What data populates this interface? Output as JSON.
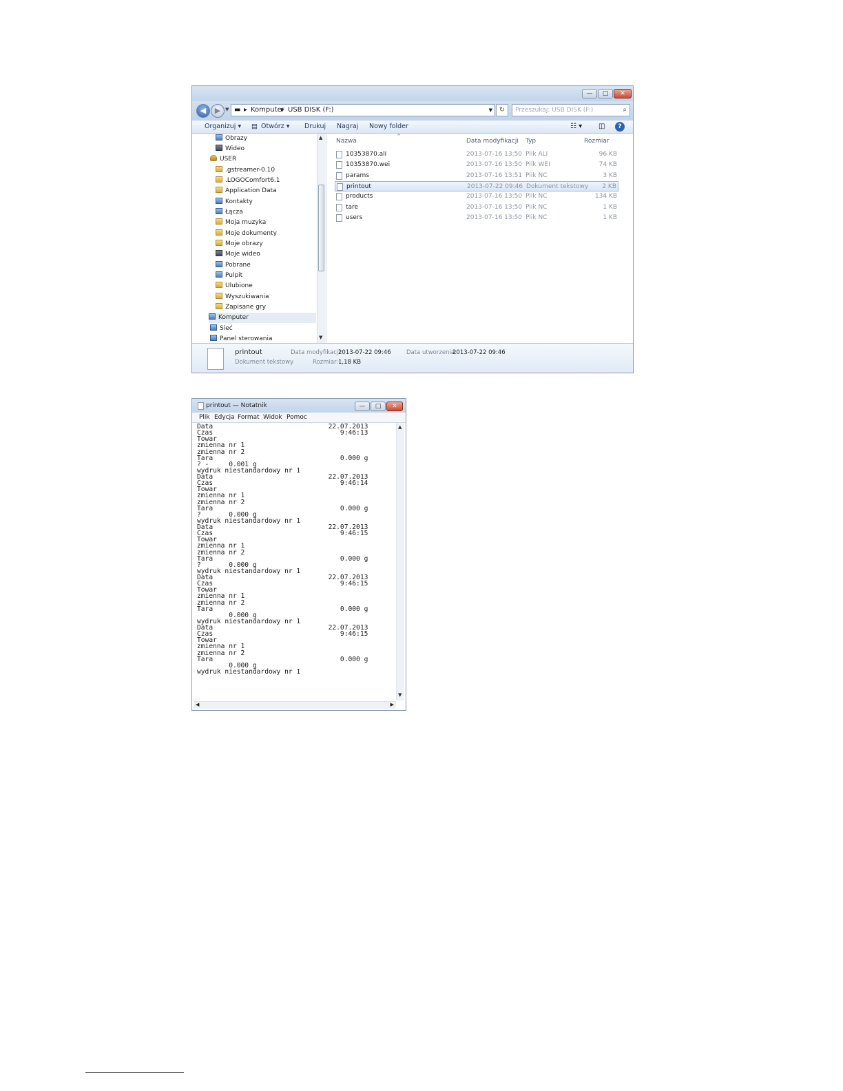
{
  "explorer": {
    "window_controls": {
      "minimize": "—",
      "maximize": "□",
      "close": "✕"
    },
    "nav": {
      "back": "◀",
      "forward": "▶"
    },
    "address": {
      "segments": [
        "Komputer",
        "USB DISK (F:)"
      ],
      "separator": "▸"
    },
    "search": {
      "placeholder": "Przeszukaj: USB DISK (F:)"
    },
    "toolbar": {
      "organize": "Organizuj ▾",
      "open": "Otwórz ▾",
      "print": "Drukuj",
      "burn": "Nagraj",
      "new_folder": "Nowy folder"
    },
    "nav_pane": [
      {
        "label": "Obrazy",
        "icon": "pictures-icon"
      },
      {
        "label": "Wideo",
        "icon": "video-icon"
      },
      {
        "label": "USER",
        "icon": "user-folder-icon"
      },
      {
        "label": ".gstreamer-0.10",
        "icon": "folder-icon"
      },
      {
        "label": ".LOGOComfort6.1",
        "icon": "folder-icon"
      },
      {
        "label": "Application Data",
        "icon": "folder-icon"
      },
      {
        "label": "Kontakty",
        "icon": "contacts-icon"
      },
      {
        "label": "Łącza",
        "icon": "links-icon"
      },
      {
        "label": "Moja muzyka",
        "icon": "folder-icon"
      },
      {
        "label": "Moje dokumenty",
        "icon": "folder-icon"
      },
      {
        "label": "Moje obrazy",
        "icon": "folder-icon"
      },
      {
        "label": "Moje wideo",
        "icon": "folder-icon"
      },
      {
        "label": "Pobrane",
        "icon": "downloads-icon"
      },
      {
        "label": "Pulpit",
        "icon": "desktop-icon"
      },
      {
        "label": "Ulubione",
        "icon": "favorites-icon"
      },
      {
        "label": "Wyszukiwania",
        "icon": "searches-icon"
      },
      {
        "label": "Zapisane gry",
        "icon": "saved-games-icon"
      },
      {
        "label": "Komputer",
        "icon": "computer-icon"
      },
      {
        "label": "Sieć",
        "icon": "network-icon"
      },
      {
        "label": "Panel sterowania",
        "icon": "control-panel-icon"
      }
    ],
    "columns": {
      "name": "Nazwa",
      "modified": "Data modyfikacji",
      "type": "Typ",
      "size": "Rozmiar"
    },
    "files": [
      {
        "name": "10353870.ali",
        "modified": "2013-07-16 13:50",
        "type": "Plik ALI",
        "size": "96 KB"
      },
      {
        "name": "10353870.wei",
        "modified": "2013-07-16 13:50",
        "type": "Plik WEI",
        "size": "74 KB"
      },
      {
        "name": "params",
        "modified": "2013-07-16 13:51",
        "type": "Plik NC",
        "size": "3 KB"
      },
      {
        "name": "printout",
        "modified": "2013-07-22 09:46",
        "type": "Dokument tekstowy",
        "size": "2 KB"
      },
      {
        "name": "products",
        "modified": "2013-07-16 13:50",
        "type": "Plik NC",
        "size": "134 KB"
      },
      {
        "name": "tare",
        "modified": "2013-07-16 13:50",
        "type": "Plik NC",
        "size": "1 KB"
      },
      {
        "name": "users",
        "modified": "2013-07-16 13:50",
        "type": "Plik NC",
        "size": "1 KB"
      }
    ],
    "selected_file": "printout",
    "details": {
      "name": "printout",
      "kind": "Dokument tekstowy",
      "modified_label": "Data modyfikacji:",
      "modified_value": "2013-07-22 09:46",
      "size_label": "Rozmiar:",
      "size_value": "1,18 KB",
      "created_label": "Data utworzenia:",
      "created_value": "2013-07-22 09:46"
    }
  },
  "notepad": {
    "title": "printout — Notatnik",
    "menu": [
      "Plik",
      "Edycja",
      "Format",
      "Widok",
      "Pomoc"
    ],
    "content": "Data                             22.07.2013\nCzas                                9:46:13\nTowar\nzmienna nr 1\nzmienna nr 2\nTara                                0.000 g\n? -     0.001 g\nwydruk niestandardowy nr 1\nData                             22.07.2013\nCzas                                9:46:14\nTowar\nzmienna nr 1\nzmienna nr 2\nTara                                0.000 g\n?       0.000 g\nwydruk niestandardowy nr 1\nData                             22.07.2013\nCzas                                9:46:15\nTowar\nzmienna nr 1\nzmienna nr 2\nTara                                0.000 g\n?       0.000 g\nwydruk niestandardowy nr 1\nData                             22.07.2013\nCzas                                9:46:15\nTowar\nzmienna nr 1\nzmienna nr 2\nTara                                0.000 g\n        0.000 g\nwydruk niestandardowy nr 1\nData                             22.07.2013\nCzas                                9:46:15\nTowar\nzmienna nr 1\nzmienna nr 2\nTara                                0.000 g\n        0.000 g\nwydruk niestandardowy nr 1"
  }
}
